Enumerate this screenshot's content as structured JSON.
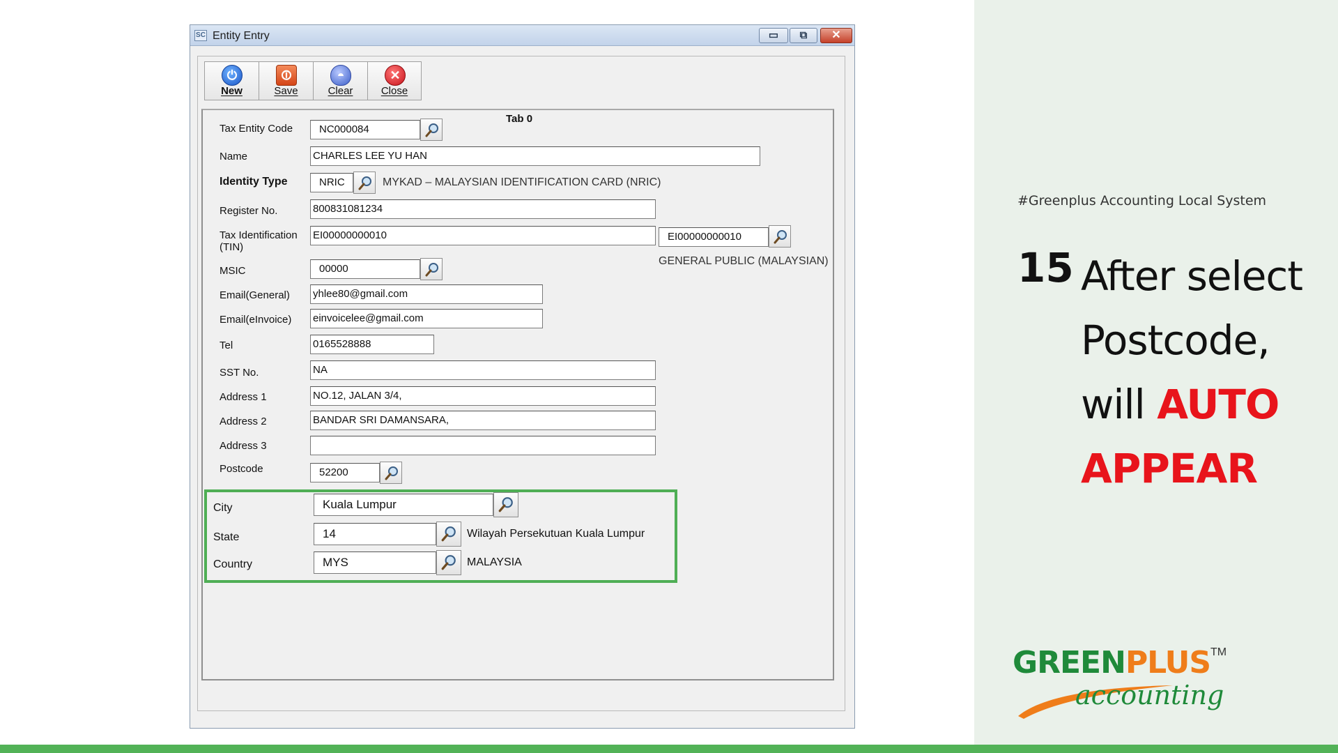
{
  "window": {
    "title": "Entity Entry",
    "app_icon": "SC"
  },
  "toolbar": {
    "new_label": "New",
    "save_label": "Save",
    "clear_label": "Clear",
    "close_label": "Close"
  },
  "tab": {
    "label": "Tab 0"
  },
  "form": {
    "tax_entity_code": {
      "label": "Tax Entity Code",
      "value": "NC000084"
    },
    "name": {
      "label": "Name",
      "value": "CHARLES LEE YU HAN"
    },
    "identity_type": {
      "label": "Identity Type",
      "value": "NRIC",
      "description": "MYKAD – MALAYSIAN IDENTIFICATION CARD (NRIC)"
    },
    "register_no": {
      "label": "Register No.",
      "value": "800831081234"
    },
    "tin": {
      "label_line1": "Tax Identification",
      "label_line2": "(TIN)",
      "value": "EI00000000010",
      "lookup_value": "EI00000000010",
      "description": "GENERAL PUBLIC (MALAYSIAN)"
    },
    "msic": {
      "label": "MSIC",
      "value": "00000"
    },
    "email_general": {
      "label": "Email(General)",
      "value": "yhlee80@gmail.com"
    },
    "email_einvoice": {
      "label": "Email(eInvoice)",
      "value": "einvoicelee@gmail.com"
    },
    "tel": {
      "label": "Tel",
      "value": "0165528888"
    },
    "sst_no": {
      "label": "SST No.",
      "value": "NA"
    },
    "address1": {
      "label": "Address 1",
      "value": "NO.12, JALAN 3/4,"
    },
    "address2": {
      "label": "Address 2",
      "value": "BANDAR SRI DAMANSARA,"
    },
    "address3": {
      "label": "Address 3",
      "value": ""
    },
    "postcode": {
      "label": "Postcode",
      "value": "52200"
    },
    "city": {
      "label": "City",
      "value": "Kuala Lumpur"
    },
    "state": {
      "label": "State",
      "value": "14",
      "description": "Wilayah Persekutuan Kuala Lumpur"
    },
    "country": {
      "label": "Country",
      "value": "MYS",
      "description": "MALAYSIA"
    }
  },
  "slide": {
    "hashtag": "#Greenplus Accounting Local System",
    "step_number": "15",
    "text_line1": "After select",
    "text_line2": "Postcode,",
    "text_line3": "will ",
    "text_auto": "AUTO",
    "text_appear": "APPEAR",
    "logo_green": "GREEN",
    "logo_plus": "PLUS",
    "logo_tm": "TM",
    "logo_sub": "accounting"
  },
  "colors": {
    "highlight_box": "#4fae55",
    "emphasis_text": "#e8141b",
    "brand_green": "#1f8a3a",
    "brand_orange": "#ef7d1a",
    "slide_panel": "#eaf1ea",
    "bottom_bar": "#52b257"
  },
  "icons": {
    "lookup": "magnifier-icon",
    "new": "power-new-icon",
    "save": "save-icon",
    "clear": "clear-icon",
    "close": "close-x-icon"
  }
}
